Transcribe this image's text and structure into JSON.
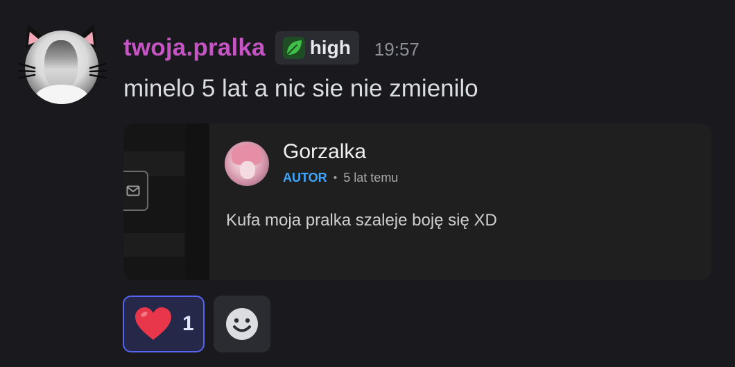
{
  "message": {
    "username": "twoja.pralka",
    "tag": {
      "icon": "leaf-icon",
      "label": "high",
      "icon_color": "#3fbf4a"
    },
    "timestamp": "19:57",
    "text": "minelo 5 lat a nic sie nie zmienilo",
    "username_color": "#c654c4"
  },
  "embed": {
    "comment": {
      "author": "Gorzalka",
      "author_badge": "AUTOR",
      "separator": "•",
      "time": "5 lat temu",
      "body": "Kufa moja pralka szaleje boję się XD"
    },
    "icons": [
      "mail-icon"
    ]
  },
  "reactions": [
    {
      "emoji": "heart",
      "count": "1",
      "active": true
    }
  ],
  "add_reaction": {
    "icon": "smiley-icon"
  }
}
